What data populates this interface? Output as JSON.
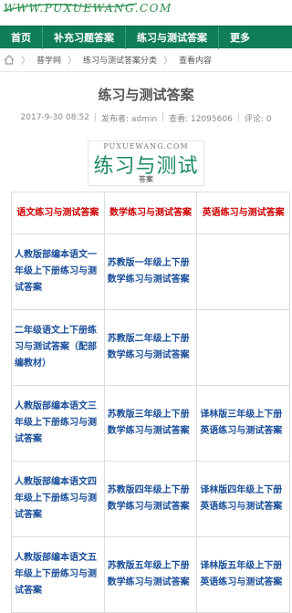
{
  "site": {
    "logo_text": "WWW.PUXUEWANG.COM"
  },
  "nav": {
    "items": [
      "首页",
      "补充习题答案",
      "练习与测试答案",
      "更多"
    ]
  },
  "breadcrumb": {
    "items": [
      "普学网",
      "练习与测试答案分类",
      "查看内容"
    ]
  },
  "article": {
    "title": "练习与测试答案",
    "date": "2017-9-30 08:52",
    "author": "发布者: admin",
    "views": "查看: 12095606",
    "comments": "评论: 0",
    "separator": "|",
    "image": {
      "url_text": "PUXUEWANG.COM",
      "main_text": "练习与测试",
      "sub_text": "答案"
    }
  },
  "table": {
    "headers": [
      "语文练习与测试答案",
      "数学练习与测试答案",
      "英语练习与测试答案"
    ],
    "rows": [
      [
        "人教版部编本语文一年级上下册练习与测试答案",
        "苏教版一年级上下册数学练习与测试答案",
        ""
      ],
      [
        "二年级语文上下册练习与测试答案（配部编教材）",
        "苏教版二年级上下册数学练习与测试答案",
        ""
      ],
      [
        "人教版部编本语文三年级上下册练习与测试答案",
        "苏教版三年级上下册数学练习与测试答案",
        "译林版三年级上下册英语练习与测试答案"
      ],
      [
        "人教版部编本语文四年级上下册练习与测试答案",
        "苏教版四年级上下册数学练习与测试答案",
        "译林版四年级上下册英语练习与测试答案"
      ],
      [
        "人教版部编本语文五年级上下册练习与测试答案",
        "苏教版五年级上下册数学练习与测试答案",
        "译林版五年级上下册英语练习与测试答案"
      ]
    ]
  },
  "colors": {
    "nav_bg": "#0f7d55",
    "header_red": "#d00000",
    "link_blue": "#1a4e9a"
  }
}
